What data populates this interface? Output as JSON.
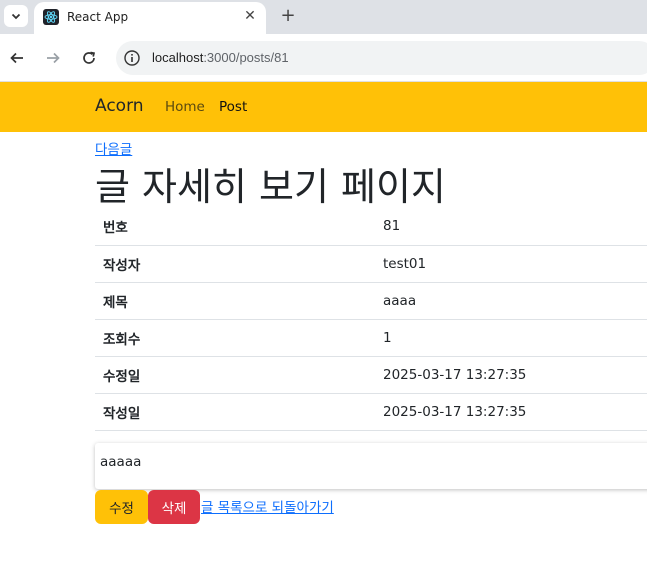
{
  "browser": {
    "tab_title": "React App",
    "url_host": "localhost",
    "url_path": ":3000/posts/81",
    "icons": {
      "tab_menu": "chevron-down-icon",
      "favicon": "react-icon",
      "close": "close-icon",
      "new_tab": "plus-icon",
      "back": "arrow-left-icon",
      "forward": "arrow-right-icon",
      "reload": "reload-icon",
      "site_info": "site-info-icon"
    }
  },
  "navbar": {
    "brand": "Acorn",
    "links": [
      "Home",
      "Post"
    ],
    "active_link": "Post",
    "color": "#ffc107"
  },
  "page": {
    "next_link": "다음글",
    "title": "글 자세히 보기 페이지",
    "rows": [
      {
        "label": "번호",
        "value": "81"
      },
      {
        "label": "작성자",
        "value": "test01"
      },
      {
        "label": "제목",
        "value": "aaaa"
      },
      {
        "label": "조회수",
        "value": "1"
      },
      {
        "label": "수정일",
        "value": "2025-03-17 13:27:35"
      },
      {
        "label": "작성일",
        "value": "2025-03-17 13:27:35"
      }
    ],
    "content": "aaaaa",
    "edit_button": "수정",
    "delete_button": "삭제",
    "back_link": "글 목록으로 되돌아가기"
  },
  "colors": {
    "accent": "#ffc107",
    "danger": "#dc3545",
    "link": "#0d6efd"
  }
}
